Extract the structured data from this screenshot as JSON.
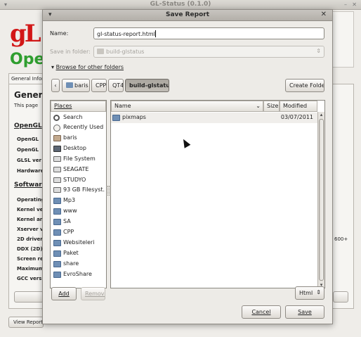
{
  "main_window": {
    "title": "GL-Status (0.1.0)",
    "tab_label": "General Information",
    "heading": "General",
    "subtitle": "This page",
    "opengl_header": "OpenGL",
    "opengl_labels": [
      "OpenGL",
      "OpenGL",
      "GLSL ver",
      "Hardware"
    ],
    "software_header": "Software",
    "software_labels": [
      "Operating",
      "Kernel ve",
      "Kernel ar",
      "Xserver v",
      "2D driver",
      "DDX (2D)",
      "Screen re",
      "Maximum",
      "GCC vers"
    ],
    "right_value": "600+",
    "view_report_label": "View Report"
  },
  "dialog": {
    "title": "Save Report",
    "name_label": "Name:",
    "name_value": "gl-status-report.html",
    "save_in_label": "Save in folder:",
    "save_in_value": "build-glstatus",
    "browse_label": "Browse for other folders",
    "path_back": "‹",
    "path_buttons": [
      "baris",
      "CPP",
      "QT4",
      "build-glstatus"
    ],
    "create_folder_label": "Create Folder",
    "places_header": "Places",
    "places": [
      {
        "label": "Search",
        "icon": "search-icon"
      },
      {
        "label": "Recently Used",
        "icon": "recent-icon"
      },
      {
        "label": "baris",
        "icon": "home-folder-icon"
      },
      {
        "label": "Desktop",
        "icon": "desktop-icon"
      },
      {
        "label": "File System",
        "icon": "drive-icon"
      },
      {
        "label": "SEAGATE",
        "icon": "drive-icon"
      },
      {
        "label": "STUDYO",
        "icon": "drive-icon"
      },
      {
        "label": "93 GB Filesyst...",
        "icon": "drive-icon"
      },
      {
        "label": "Mp3",
        "icon": "folder-icon"
      },
      {
        "label": "www",
        "icon": "folder-icon"
      },
      {
        "label": "SA",
        "icon": "folder-icon"
      },
      {
        "label": "CPP",
        "icon": "folder-icon"
      },
      {
        "label": "Websiteleri",
        "icon": "folder-icon"
      },
      {
        "label": "Paket",
        "icon": "folder-icon"
      },
      {
        "label": "share",
        "icon": "folder-icon"
      },
      {
        "label": "EvroShare",
        "icon": "folder-icon"
      }
    ],
    "columns": {
      "name": "Name",
      "size": "Size",
      "modified": "Modified"
    },
    "files": [
      {
        "name": "pixmaps",
        "size": "",
        "modified": "03/07/2011",
        "icon": "folder-icon"
      }
    ],
    "add_label": "Add",
    "remove_label": "Remove",
    "filter_value": "Html",
    "cancel_label": "Cancel",
    "save_label": "Save"
  }
}
